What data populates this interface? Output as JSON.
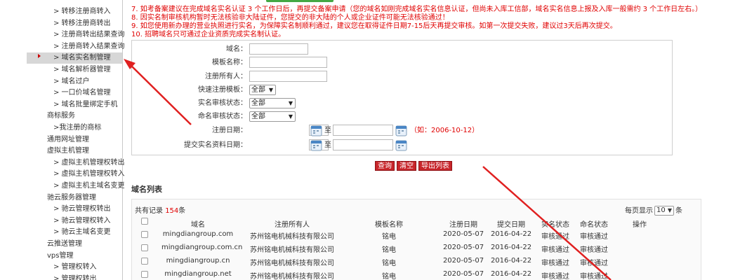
{
  "sidebar": {
    "items": [
      {
        "label": "> 转移注册商转入",
        "type": "sub"
      },
      {
        "label": "> 转移注册商转出",
        "type": "sub"
      },
      {
        "label": "> 注册商转出结果查询",
        "type": "sub"
      },
      {
        "label": "> 注册商转入结果查询",
        "type": "sub"
      },
      {
        "label": "> 域名实名制管理",
        "type": "sub",
        "active": true
      },
      {
        "label": "> 域名解析器管理",
        "type": "sub"
      },
      {
        "label": "> 域名过户",
        "type": "sub"
      },
      {
        "label": "> 一口价域名管理",
        "type": "sub"
      },
      {
        "label": "> 域名批量绑定手机",
        "type": "sub"
      },
      {
        "label": "商标服务",
        "type": "group"
      },
      {
        "label": ">我注册的商标",
        "type": "sub2"
      },
      {
        "label": "通用网址管理",
        "type": "group"
      },
      {
        "label": "虚拟主机管理",
        "type": "group"
      },
      {
        "label": "> 虚拟主机管理权转出",
        "type": "sub"
      },
      {
        "label": "> 虚拟主机管理权转入",
        "type": "sub"
      },
      {
        "label": "> 虚拟主机主域名变更",
        "type": "sub"
      },
      {
        "label": "驰云服务器管理",
        "type": "group"
      },
      {
        "label": "> 驰云管理权转出",
        "type": "sub"
      },
      {
        "label": "> 驰云管理权转入",
        "type": "sub"
      },
      {
        "label": "> 驰云主域名变更",
        "type": "sub"
      },
      {
        "label": "云推送管理",
        "type": "group"
      },
      {
        "label": "vps管理",
        "type": "group"
      },
      {
        "label": "> 管理权转入",
        "type": "sub"
      },
      {
        "label": "> 管理权转出",
        "type": "sub"
      }
    ]
  },
  "notices": [
    "7. 如考备案建议在完成域名实名认证 3 个工作日后，再提交备案申请（您的域名如刚完成域名实名信息认证，但尚未入库工信部，域名实名信息上报及入库一般需约 3 个工作日左右。）",
    "8. 因实名制审核机构暂时无法核验非大陆证件，您提交的非大陆的个人或企业证件可能无法核验通过！",
    "9. 如您使用新办理的营业执照进行实名，为保障实名制顺利通过，建议您在取得证件日期7-15后天再提交审核。如第一次提交失败，建议过3天后再次提交。",
    "10. 招聘域名只可通过企业资质完成实名制认证。"
  ],
  "search_form": {
    "domain_label": "域名：",
    "template_name_label": "模板名称：",
    "registrant_label": "注册所有人：",
    "quick_template_label": "快速注册模板：",
    "quick_template_value": "全部",
    "verify_status_label": "实名审核状态：",
    "verify_status_value": "全部",
    "naming_status_label": "命名审核状态：",
    "naming_status_value": "全部",
    "reg_date_label": "注册日期：",
    "submit_date_label": "提交实名资料日期：",
    "to_text": "至",
    "date_hint": "（如：2006-10-12）"
  },
  "buttons": {
    "query": "查询",
    "clear": "清空",
    "export": "导出列表"
  },
  "domain_list": {
    "title": "域名列表",
    "count_prefix": "共有记录",
    "count": "154",
    "count_suffix": "条",
    "per_page_prefix": "每页显示",
    "per_page_value": "10",
    "per_page_suffix": "条",
    "columns": [
      "域名",
      "注册所有人",
      "模板名称",
      "注册日期",
      "提交日期",
      "实名状态",
      "命名状态",
      "操作"
    ],
    "rows": [
      {
        "domain": "mingdiangroup.com",
        "owner": "苏州铭电机械科技有限公司",
        "template": "铭电",
        "reg_date": "2020-05-07",
        "submit_date": "2016-04-22",
        "verify": "审核通过",
        "naming": "审核通过"
      },
      {
        "domain": "mingdiangroup.com.cn",
        "owner": "苏州铭电机械科技有限公司",
        "template": "铭电",
        "reg_date": "2020-05-07",
        "submit_date": "2016-04-22",
        "verify": "审核通过",
        "naming": "审核通过"
      },
      {
        "domain": "mingdiangroup.cn",
        "owner": "苏州铭电机械科技有限公司",
        "template": "铭电",
        "reg_date": "2020-05-07",
        "submit_date": "2016-04-22",
        "verify": "审核通过",
        "naming": "审核通过"
      },
      {
        "domain": "mingdiangroup.net",
        "owner": "苏州铭电机械科技有限公司",
        "template": "铭电",
        "reg_date": "2020-05-07",
        "submit_date": "2016-04-22",
        "verify": "审核通过",
        "naming": "审核通过"
      }
    ]
  },
  "colors": {
    "notice_red": "#e00000",
    "button_red": "#c8262b",
    "arrow_red": "#e02020",
    "active_item_bg": "#d7d7d7"
  }
}
